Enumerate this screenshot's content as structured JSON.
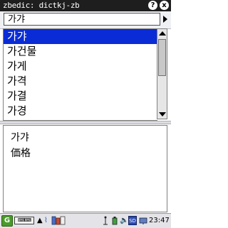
{
  "window": {
    "title": "zbedic: dictkj-zb",
    "help_label": "?",
    "close_label": "x"
  },
  "search": {
    "value": "가갸"
  },
  "word_list": {
    "items": [
      "가갸",
      "가건물",
      "가게",
      "가격",
      "가결",
      "가경"
    ],
    "selected_index": 0
  },
  "entry": {
    "headword": "가갸",
    "definition": "価格"
  },
  "taskbar": {
    "clock": "23:47",
    "tray_icons": [
      "up-arrow-icon",
      "wifi-icon",
      "books-icon",
      "antenna-icon",
      "battery-icon",
      "volume-icon",
      "sd-card-icon",
      "network-icon"
    ],
    "sd_label": "SD"
  }
}
